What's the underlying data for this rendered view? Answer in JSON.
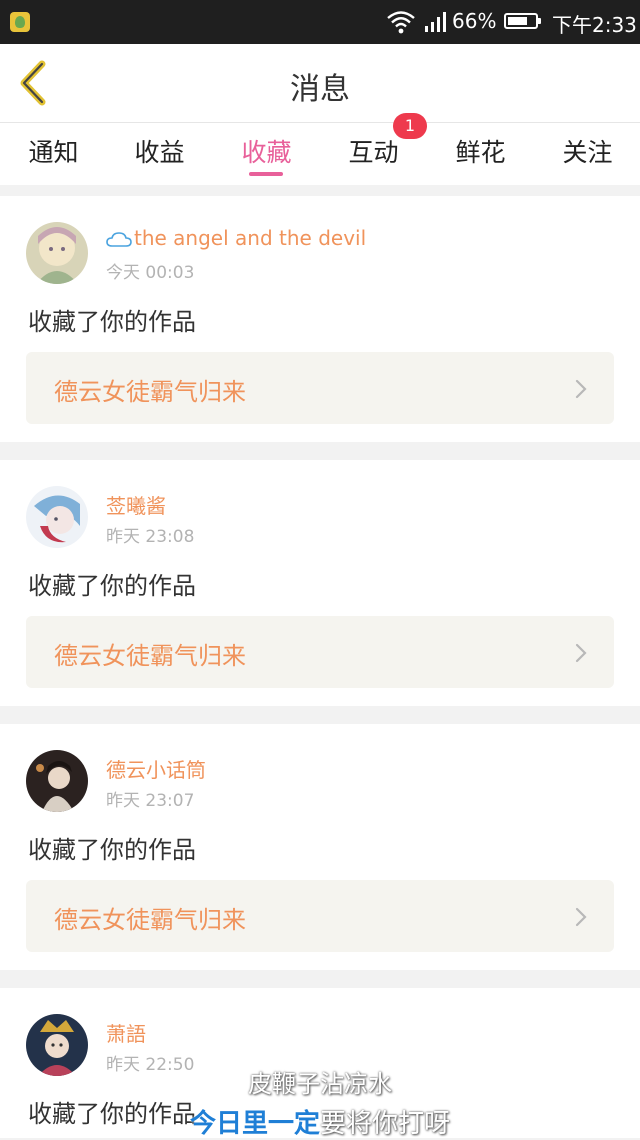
{
  "status_bar": {
    "battery": "66%",
    "time": "下午2:33",
    "icons": [
      "app-icon",
      "wifi-icon",
      "signal-icon",
      "battery-icon"
    ]
  },
  "header": {
    "title": "消息",
    "back_icon": "chevron-left-icon"
  },
  "tabs": [
    {
      "label": "通知"
    },
    {
      "label": "收益"
    },
    {
      "label": "收藏",
      "active": true
    },
    {
      "label": "互动",
      "badge": "1"
    },
    {
      "label": "鲜花"
    },
    {
      "label": "关注"
    }
  ],
  "accent_color": "#e8609a",
  "name_color": "#f0935b",
  "notifications": [
    {
      "user": "the angel and the devil",
      "user_icon": "cloud-icon",
      "time": "今天 00:03",
      "action": "收藏了你的作品",
      "work": "德云女徒霸气归来"
    },
    {
      "user": "莶曦酱",
      "time": "昨天 23:08",
      "action": "收藏了你的作品",
      "work": "德云女徒霸气归来"
    },
    {
      "user": "德云小话筒",
      "time": "昨天 23:07",
      "action": "收藏了你的作品",
      "work": "德云女徒霸气归来"
    },
    {
      "user": "萧語",
      "time": "昨天 22:50",
      "action": "收藏了你的作品",
      "work": ""
    }
  ],
  "subtitle": {
    "line1": "皮鞭子沾凉水",
    "line2_highlight": "今日里一定",
    "line2_rest": "要将你打呀"
  }
}
